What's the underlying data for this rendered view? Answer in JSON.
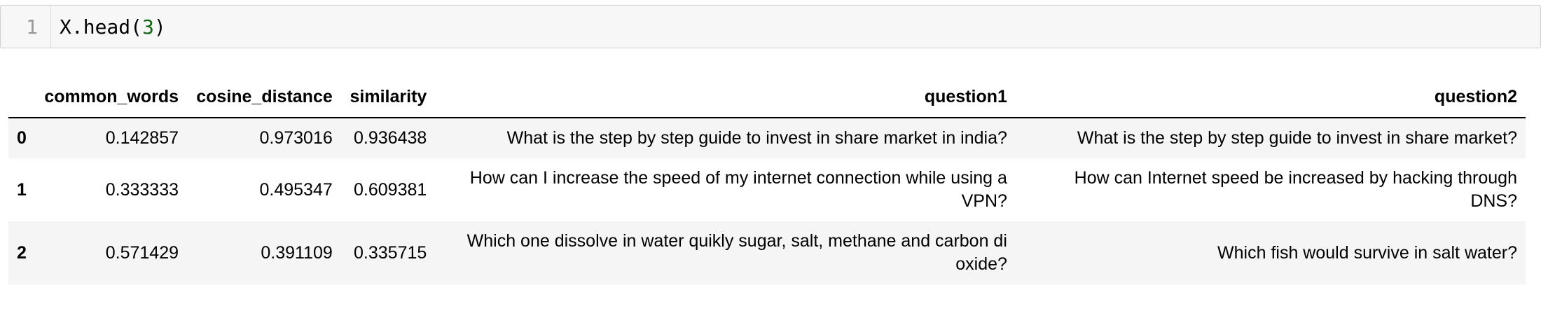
{
  "code_cell": {
    "line_number": "1",
    "code_prefix": "X.head(",
    "code_arg": "3",
    "code_suffix": ")"
  },
  "dataframe": {
    "columns": [
      "",
      "common_words",
      "cosine_distance",
      "similarity",
      "question1",
      "question2"
    ],
    "rows": [
      {
        "index": "0",
        "common_words": "0.142857",
        "cosine_distance": "0.973016",
        "similarity": "0.936438",
        "question1": "What is the step by step guide to invest in share market in india?",
        "question2": "What is the step by step guide to invest in share market?"
      },
      {
        "index": "1",
        "common_words": "0.333333",
        "cosine_distance": "0.495347",
        "similarity": "0.609381",
        "question1": "How can I increase the speed of my internet connection while using a VPN?",
        "question2": "How can Internet speed be increased by hacking through DNS?"
      },
      {
        "index": "2",
        "common_words": "0.571429",
        "cosine_distance": "0.391109",
        "similarity": "0.335715",
        "question1": "Which one dissolve in water quikly sugar, salt, methane and carbon di oxide?",
        "question2": "Which fish would survive in salt water?"
      }
    ]
  }
}
